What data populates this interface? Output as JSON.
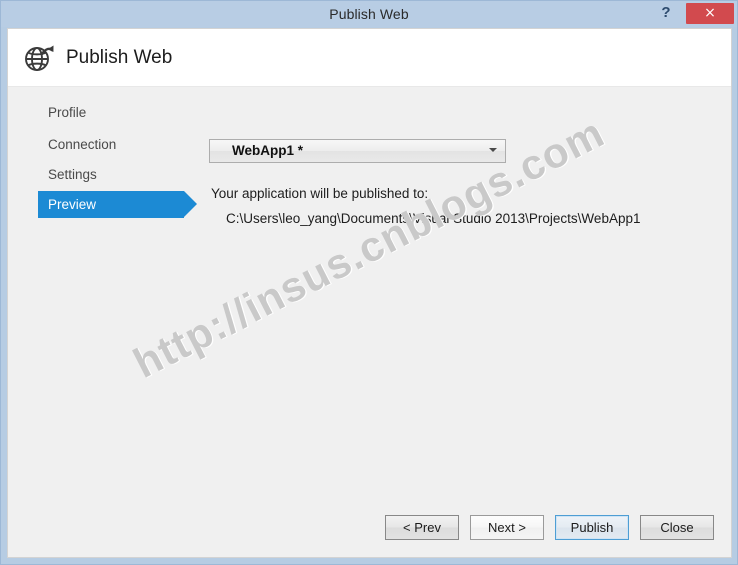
{
  "window": {
    "title": "Publish Web",
    "help_label": "?",
    "close_label": "×",
    "accent_color": "#1c8ad4",
    "titlebar_color": "#b8cde4",
    "close_color": "#d24a4e"
  },
  "header": {
    "title": "Publish Web",
    "icon": "globe-publish-icon"
  },
  "sidebar": {
    "items": [
      {
        "label": "Profile",
        "selected": false
      },
      {
        "label": "Connection",
        "selected": false
      },
      {
        "label": "Settings",
        "selected": false
      },
      {
        "label": "Preview",
        "selected": true
      }
    ]
  },
  "content": {
    "profile_select": {
      "value": "WebApp1 *",
      "chevron": "chevron-down-icon"
    },
    "publish_label": "Your application will be published to:",
    "publish_path": "C:\\Users\\leo_yang\\Documents\\Visual Studio 2013\\Projects\\WebApp1"
  },
  "watermark": {
    "text": "http://insus.cnblogs.com"
  },
  "footer": {
    "buttons": [
      {
        "label": "< Prev",
        "style": "normal"
      },
      {
        "label": "Next >",
        "style": "light"
      },
      {
        "label": "Publish",
        "style": "default"
      },
      {
        "label": "Close",
        "style": "normal"
      }
    ]
  }
}
